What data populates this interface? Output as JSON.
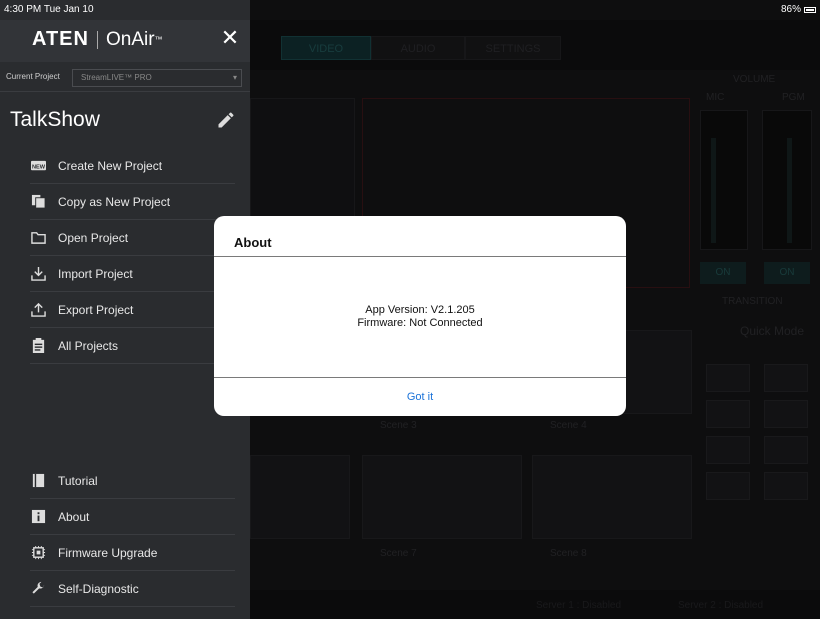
{
  "status_bar": {
    "time": "4:30 PM  Tue Jan 10",
    "battery": "86%"
  },
  "background": {
    "tabs": [
      "VIDEO",
      "AUDIO",
      "SETTINGS"
    ],
    "volume_label": "VOLUME",
    "mic_label": "MIC",
    "pgm_label": "PGM",
    "on_label": "ON",
    "transition_label": "TRANSITION",
    "quick_mode_label": "Quick Mode",
    "scene_labels": [
      "Scene 3",
      "Scene 4",
      "Scene 7",
      "Scene 8"
    ],
    "footer": {
      "server1": "Server 1 : Disabled",
      "server2": "Server 2 : Disabled"
    }
  },
  "sidebar": {
    "brand": "ATEN",
    "product": "OnAir",
    "trademark": "™",
    "current_project_label": "Current Project",
    "current_project_value": "StreamLIVE™ PRO",
    "project_name": "TalkShow",
    "menu_top": [
      {
        "label": "Create New Project",
        "icon": "new-badge-icon"
      },
      {
        "label": "Copy as New Project",
        "icon": "copy-icon"
      },
      {
        "label": "Open Project",
        "icon": "folder-icon"
      },
      {
        "label": "Import Project",
        "icon": "import-icon"
      },
      {
        "label": "Export Project",
        "icon": "export-icon"
      },
      {
        "label": "All Projects",
        "icon": "clipboard-icon"
      }
    ],
    "menu_bottom": [
      {
        "label": "Tutorial",
        "icon": "book-icon"
      },
      {
        "label": "About",
        "icon": "info-icon"
      },
      {
        "label": "Firmware Upgrade",
        "icon": "chip-icon"
      },
      {
        "label": "Self-Diagnostic",
        "icon": "wrench-icon"
      }
    ]
  },
  "modal": {
    "title": "About",
    "app_version": "App Version: V2.1.205",
    "firmware": "Firmware: Not Connected",
    "button": "Got it"
  },
  "colors": {
    "accent": "#1a72d8",
    "sidebar_bg": "#2a2c2f",
    "active_tab": "#173d40"
  }
}
